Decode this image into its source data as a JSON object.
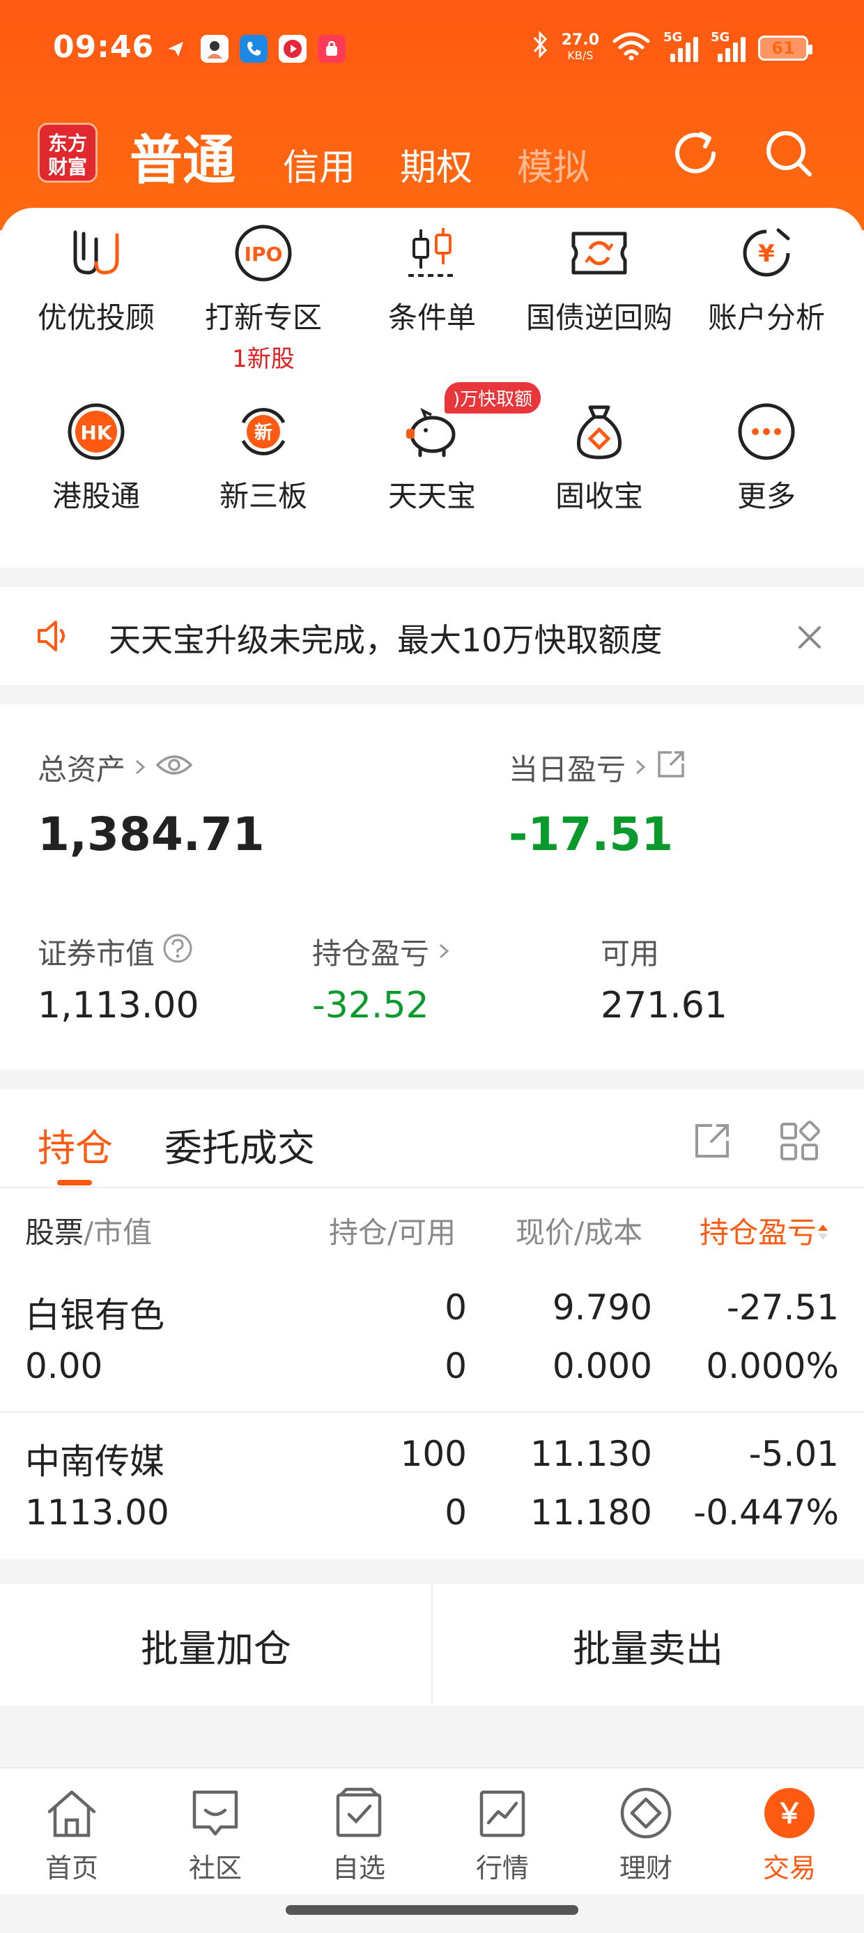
{
  "status": {
    "time": "09:46",
    "net_speed": "27.0",
    "net_unit": "KB/S",
    "sig1": "5G",
    "sig2": "5G",
    "battery": "61"
  },
  "header": {
    "logo_line1": "东方",
    "logo_line2": "财富",
    "tabs": [
      "普通",
      "信用",
      "期权",
      "模拟"
    ]
  },
  "menu": {
    "items": [
      {
        "label": "优优投顾"
      },
      {
        "label": "打新专区",
        "sub": "1新股"
      },
      {
        "label": "条件单"
      },
      {
        "label": "国债逆回购"
      },
      {
        "label": "账户分析"
      },
      {
        "label": "港股通",
        "icon_text": "HK"
      },
      {
        "label": "新三板",
        "icon_text": "新"
      },
      {
        "label": "天天宝",
        "badge": ")万快取额"
      },
      {
        "label": "固收宝"
      },
      {
        "label": "更多"
      }
    ],
    "ipo_icon_text": "IPO",
    "yen_icon_text": "¥"
  },
  "notice": {
    "text": "天天宝升级未完成，最大10万快取额度"
  },
  "assets": {
    "total_label": "总资产",
    "total_value": "1,384.71",
    "daily_label": "当日盈亏",
    "daily_value": "-17.51",
    "market_label": "证券市值",
    "market_value": "1,113.00",
    "position_pl_label": "持仓盈亏",
    "position_pl_value": "-32.52",
    "available_label": "可用",
    "available_value": "271.61"
  },
  "holdings": {
    "tabs": [
      "持仓",
      "委托成交"
    ],
    "headers": {
      "stock_a": "股票",
      "stock_b": "/市值",
      "position": "持仓/可用",
      "price": "现价/成本",
      "pl": "持仓盈亏"
    },
    "rows": [
      {
        "name": "白银有色",
        "value": "0.00",
        "hold": "0",
        "avail": "0",
        "price": "9.790",
        "cost": "0.000",
        "pl": "-27.51",
        "pl_pct": "0.000%"
      },
      {
        "name": "中南传媒",
        "value": "1113.00",
        "hold": "100",
        "avail": "0",
        "price": "11.130",
        "cost": "11.180",
        "pl": "-5.01",
        "pl_pct": "-0.447%"
      }
    ]
  },
  "batch": {
    "add": "批量加仓",
    "sell": "批量卖出"
  },
  "nav": {
    "items": [
      "首页",
      "社区",
      "自选",
      "行情",
      "理财",
      "交易"
    ],
    "trade_icon_text": "￥"
  },
  "colors": {
    "brand_orange": "#ff5a12",
    "loss_green": "#0a9a2c",
    "badge_red": "#e8363a"
  }
}
